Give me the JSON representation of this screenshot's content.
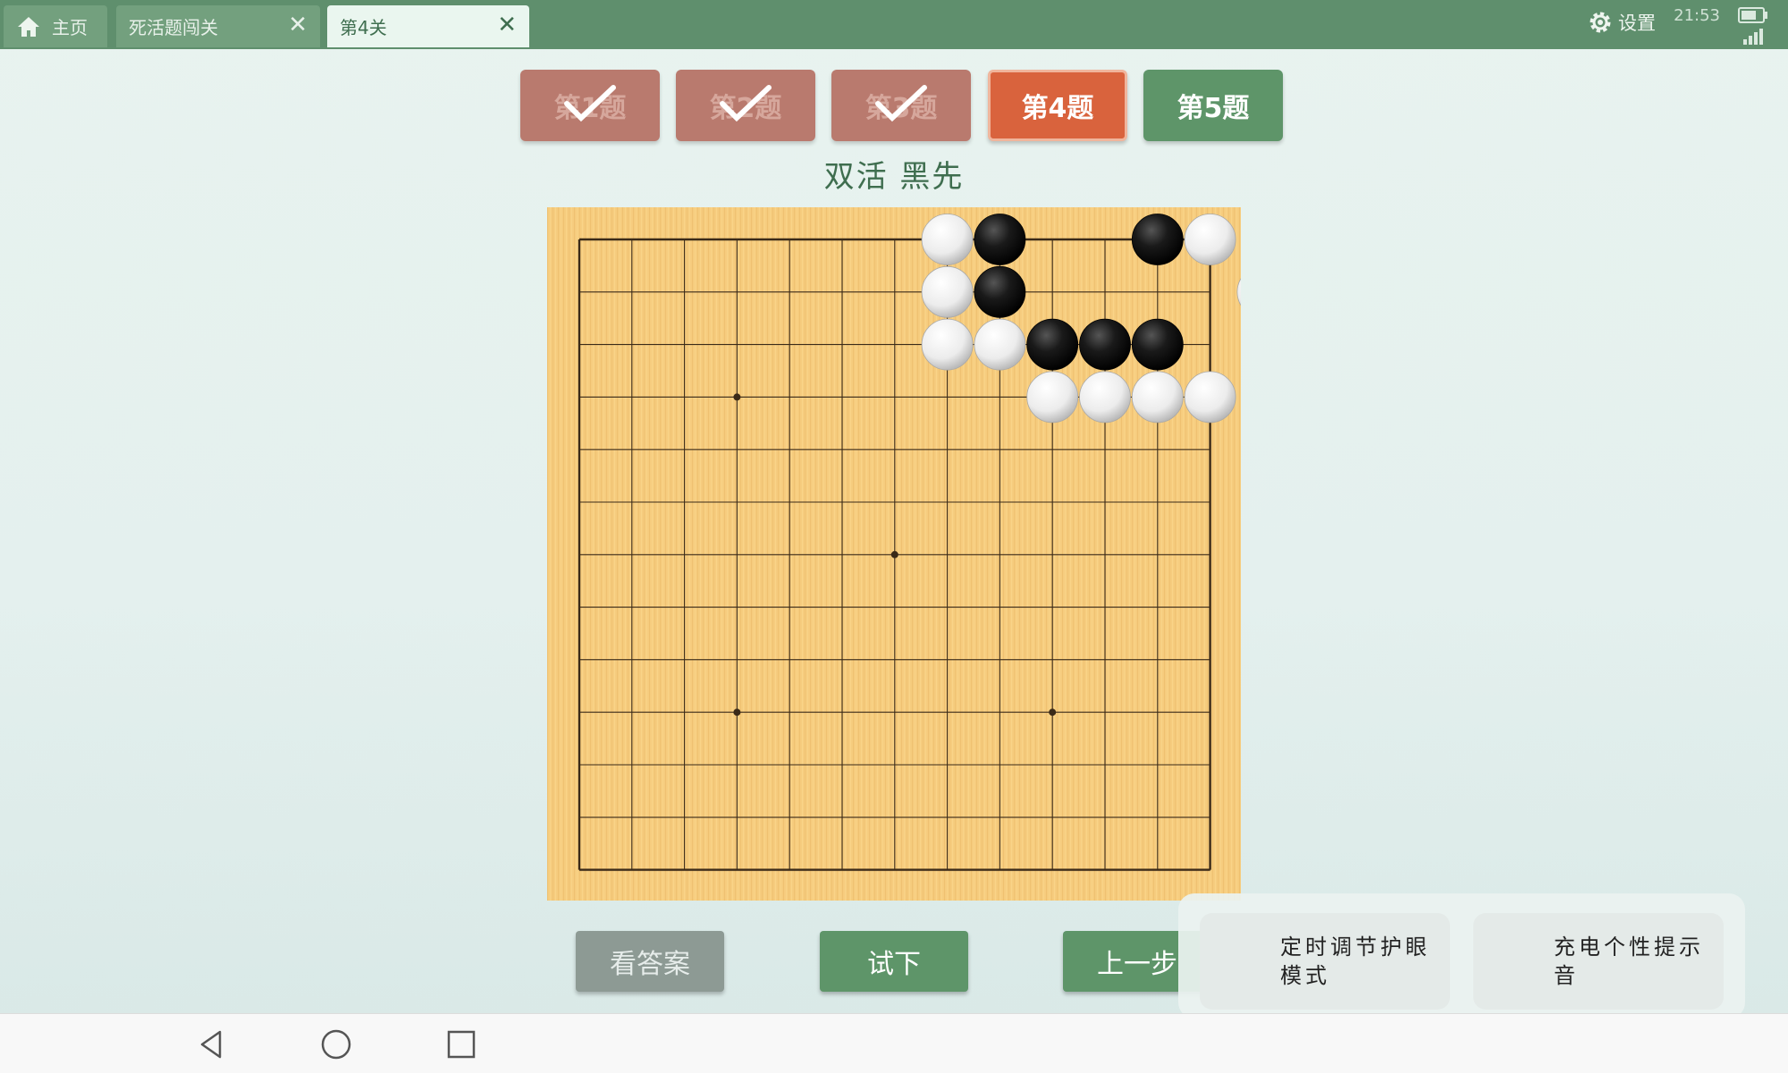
{
  "tabs": [
    {
      "label": "主页",
      "icon": "home-icon"
    },
    {
      "label": "死活题闯关",
      "close": "✕"
    },
    {
      "label": "第4关",
      "close": "✕",
      "active": true
    }
  ],
  "status": {
    "settings_label": "设置",
    "time": "21:53",
    "battery_level": 0.8
  },
  "problems": [
    {
      "label": "第1题",
      "state": "done"
    },
    {
      "label": "第2题",
      "state": "done"
    },
    {
      "label": "第3题",
      "state": "done"
    },
    {
      "label": "第4题",
      "state": "current"
    },
    {
      "label": "第5题",
      "state": "next"
    }
  ],
  "subtitle": "双活  黑先",
  "board": {
    "size": 13,
    "star_points": [
      [
        3,
        3
      ],
      [
        6,
        6
      ],
      [
        3,
        9
      ],
      [
        9,
        9
      ]
    ],
    "black": [
      [
        8,
        0
      ],
      [
        11,
        0
      ],
      [
        8,
        1
      ],
      [
        9,
        2
      ],
      [
        10,
        2
      ],
      [
        11,
        2
      ]
    ],
    "white": [
      [
        7,
        0
      ],
      [
        12,
        0
      ],
      [
        7,
        1
      ],
      [
        13,
        1
      ],
      [
        7,
        2
      ],
      [
        8,
        2
      ],
      [
        9,
        3
      ],
      [
        10,
        3
      ],
      [
        11,
        3
      ],
      [
        12,
        3
      ]
    ],
    "colors": {
      "wood": "#f6cc7e",
      "line": "#3a2a18"
    }
  },
  "actions": {
    "answer": "看答案",
    "try": "试下",
    "undo": "上一步"
  },
  "popups": {
    "eye_mode": "定时调节护眼模式",
    "charge_sound": "充电个性提示音"
  },
  "colors": {
    "topbar": "#5f8f6d",
    "accent_orange": "#d9633d",
    "accent_green": "#5e9569",
    "done_red": "#b97a6e"
  }
}
